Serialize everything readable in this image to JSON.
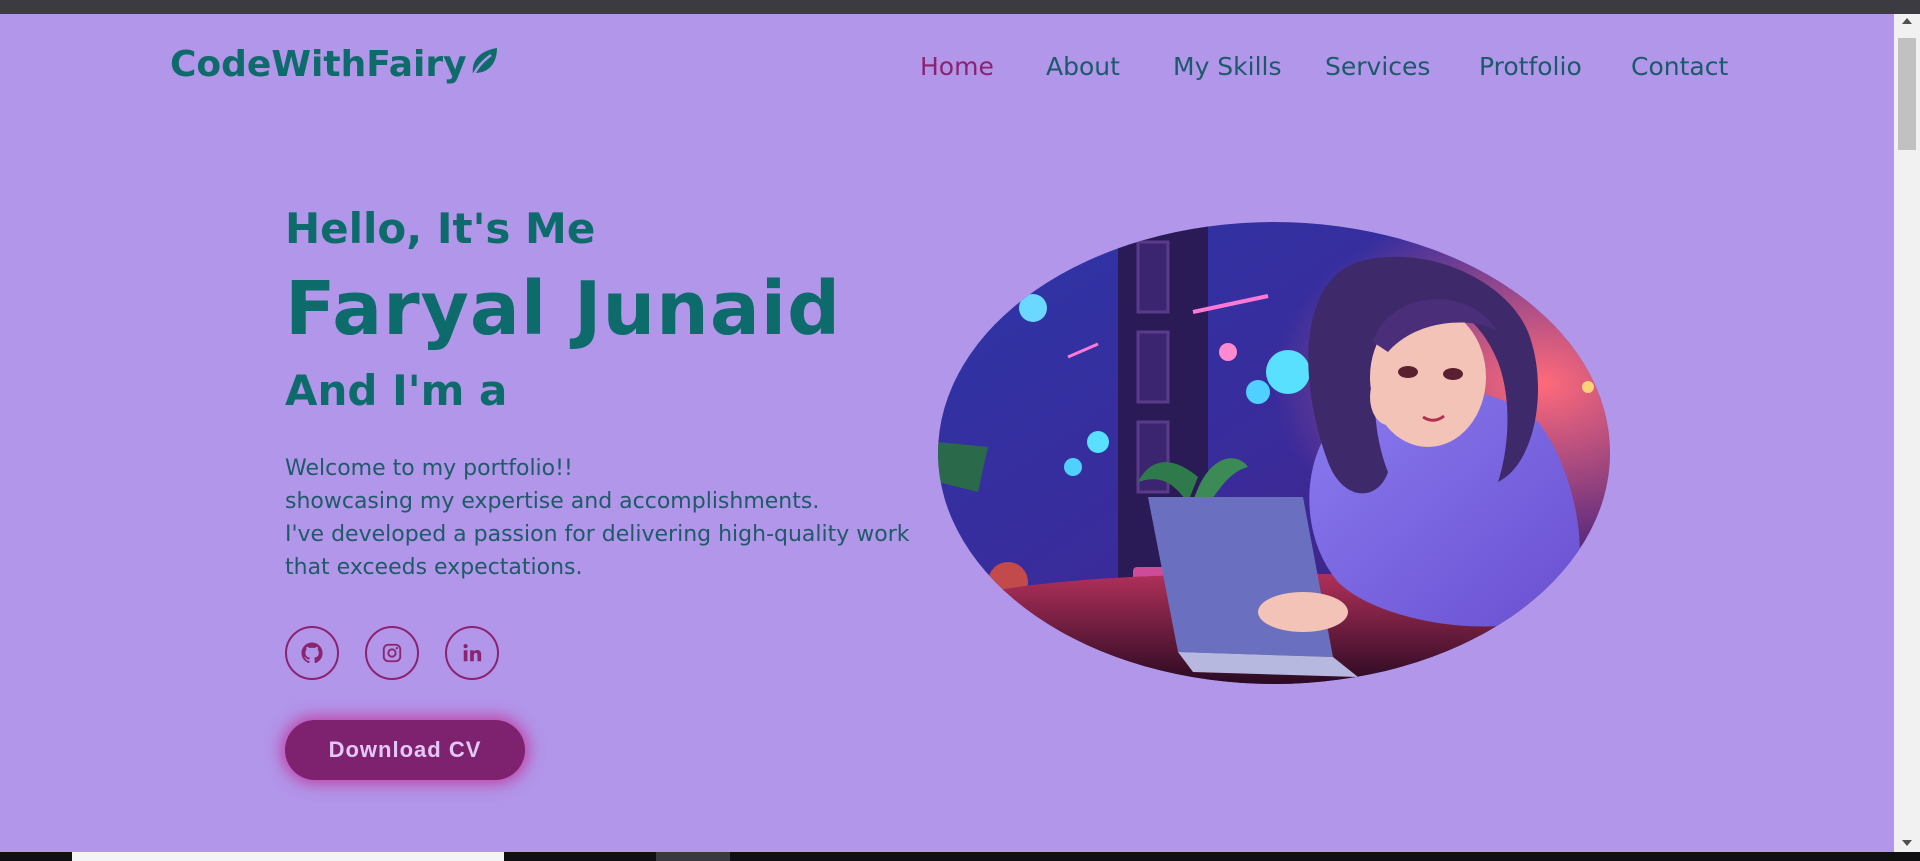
{
  "logo": {
    "text": "CodeWithFairy",
    "icon": "leaf-icon"
  },
  "nav": {
    "items": [
      {
        "label": "Home",
        "active": true
      },
      {
        "label": "About"
      },
      {
        "label": "My Skills"
      },
      {
        "label": "Services"
      },
      {
        "label": "Protfolio"
      },
      {
        "label": "Contact"
      }
    ]
  },
  "hero": {
    "greeting": "Hello, It's Me",
    "name": "Faryal Junaid",
    "role_prefix": "And I'm a",
    "description": [
      "Welcome to my portfolio!!",
      "showcasing my expertise and accomplishments.",
      "I've developed a passion for delivering high-quality work",
      "that exceeds expectations."
    ],
    "socials": [
      {
        "icon": "github-icon"
      },
      {
        "icon": "instagram-icon"
      },
      {
        "icon": "linkedin-icon"
      }
    ],
    "cta_label": "Download CV",
    "image_icon": "girl-with-laptop-illustration"
  },
  "colors": {
    "background": "#b196ea",
    "accent": "#8a2370",
    "heading": "#0e6b6b",
    "button": "#7e2270"
  }
}
